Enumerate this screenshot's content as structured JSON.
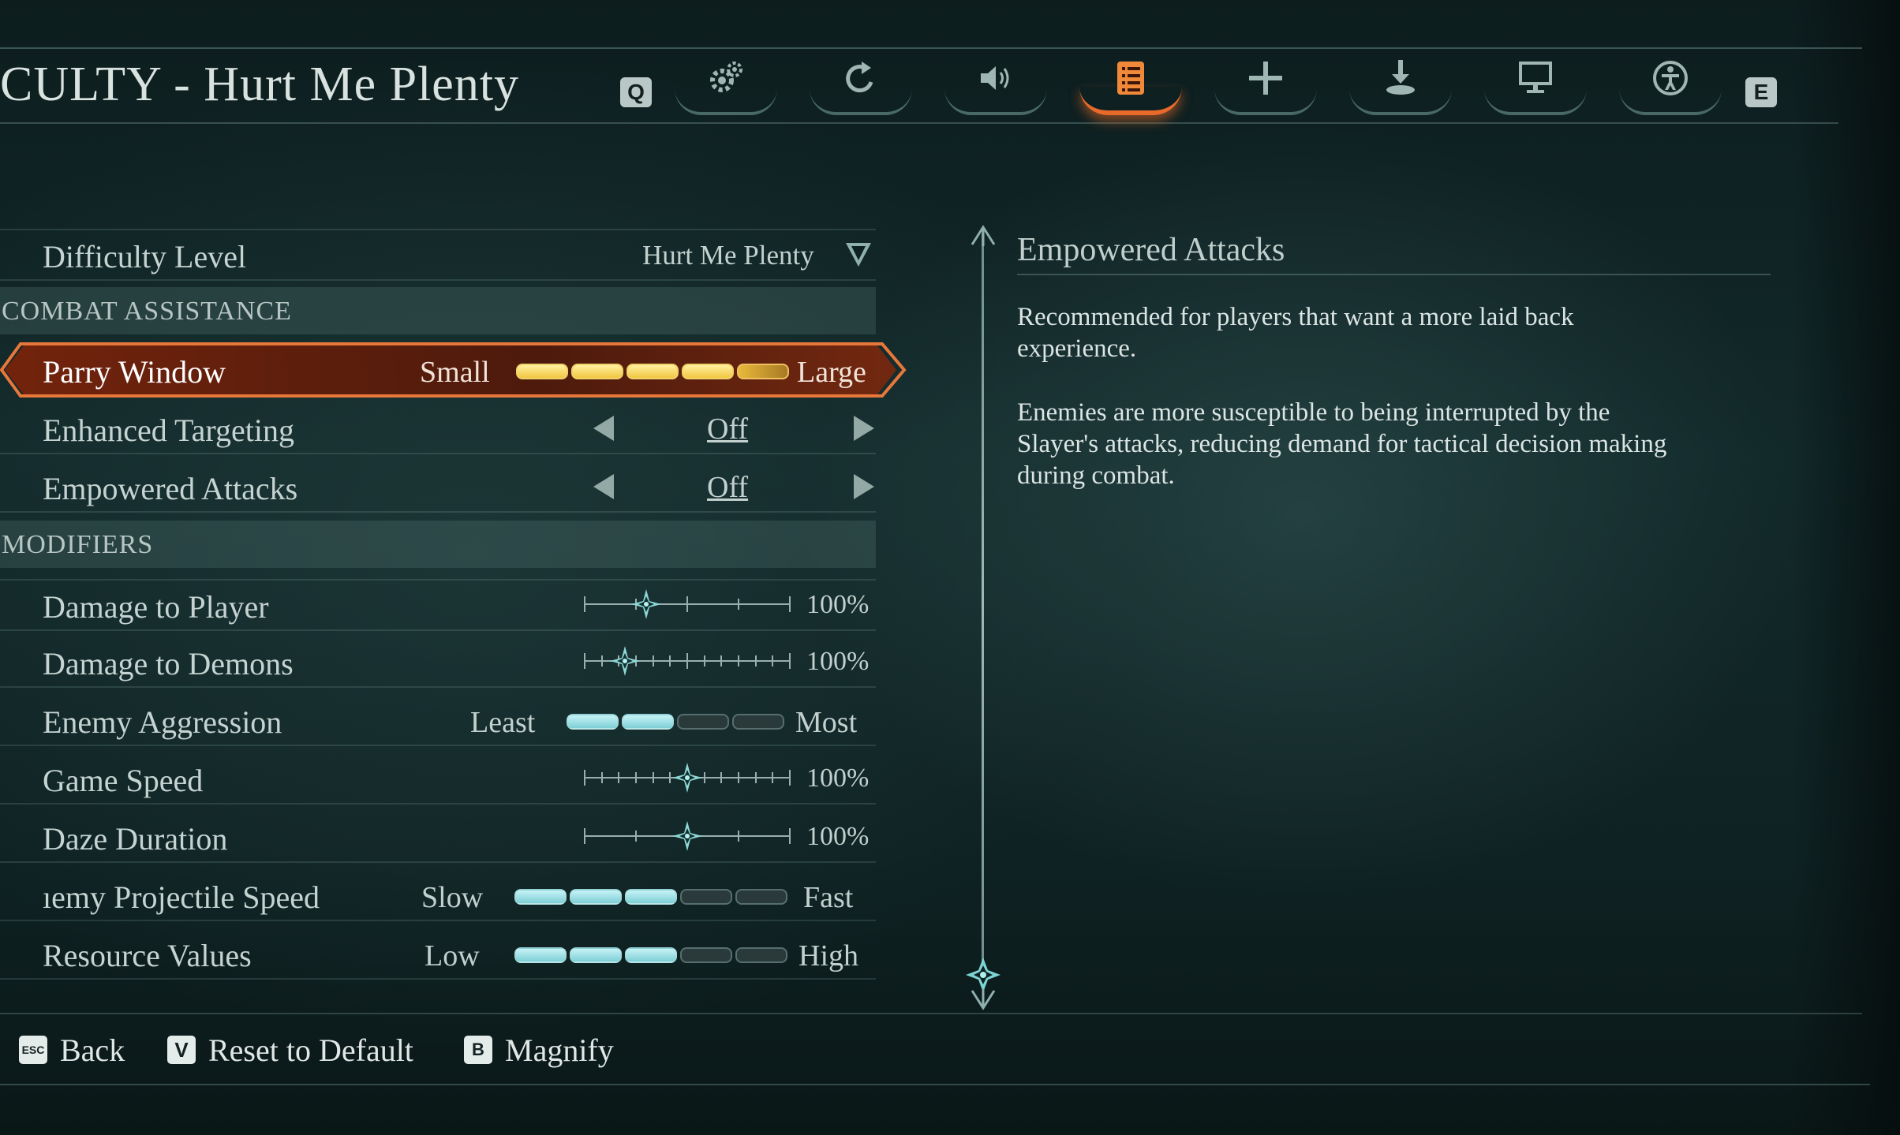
{
  "header": {
    "title": "CULTY - Hurt Me Plenty",
    "prev_key": "Q",
    "next_key": "E",
    "tabs": [
      {
        "icon": "gears-icon",
        "active": false
      },
      {
        "icon": "refresh-icon",
        "active": false
      },
      {
        "icon": "speaker-icon",
        "active": false
      },
      {
        "icon": "list-icon",
        "active": true
      },
      {
        "icon": "move-arrows-icon",
        "active": false
      },
      {
        "icon": "download-icon",
        "active": false
      },
      {
        "icon": "monitor-icon",
        "active": false
      },
      {
        "icon": "accessibility-icon",
        "active": false
      }
    ]
  },
  "settings": {
    "difficulty": {
      "label": "Difficulty Level",
      "value": "Hurt Me Plenty"
    },
    "combat_section": "COMBAT ASSISTANCE",
    "parry": {
      "label": "Parry Window",
      "min": "Small",
      "max": "Large",
      "level": 0.9
    },
    "enhanced_targeting": {
      "label": "Enhanced Targeting",
      "value": "Off"
    },
    "empowered_attacks": {
      "label": "Empowered Attacks",
      "value": "Off"
    },
    "modifiers_section": "MODIFIERS",
    "damage_player": {
      "label": "Damage to Player",
      "value": "100%",
      "level": 0.3
    },
    "damage_demons": {
      "label": "Damage to Demons",
      "value": "100%",
      "level": 0.2
    },
    "enemy_aggression": {
      "label": "Enemy Aggression",
      "min": "Least",
      "max": "Most",
      "level": 0.4
    },
    "game_speed": {
      "label": "Game Speed",
      "value": "100%",
      "level": 0.5
    },
    "daze_duration": {
      "label": "Daze Duration",
      "value": "100%",
      "level": 0.5
    },
    "projectile_speed": {
      "label": "ıemy Projectile Speed",
      "min": "Slow",
      "max": "Fast",
      "level": 0.6
    },
    "resource_values": {
      "label": "Resource Values",
      "min": "Low",
      "max": "High",
      "level": 0.6
    }
  },
  "description": {
    "title": "Empowered Attacks",
    "para1": "Recommended for players that want a more laid back experience.",
    "para2": "Enemies are more susceptible to being interrupted by the Slayer's attacks, reducing demand for tactical decision making during combat."
  },
  "footer": {
    "back_key": "ESC",
    "back_label": "Back",
    "reset_key": "V",
    "reset_label": "Reset to Default",
    "magnify_key": "B",
    "magnify_label": "Magnify"
  },
  "colors": {
    "accent": "#e86a2a",
    "bar_on": "#9fe3e8",
    "parry_fill": "#f2c640"
  }
}
